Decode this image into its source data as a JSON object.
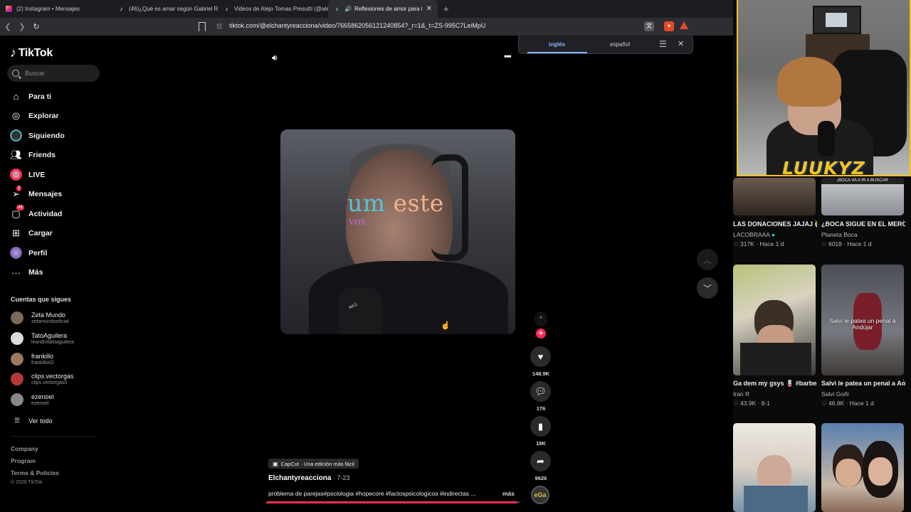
{
  "browser": {
    "tabs": [
      {
        "label": "(2) Instagram • Mensajes",
        "icon": "instagram-icon"
      },
      {
        "label": "(46)¿Qué es amar según Gabriel Rolón",
        "icon": "tiktok-icon"
      },
      {
        "label": "Videos de Alejo Tomas Presutti (@alejo",
        "icon": "tiktok-icon"
      },
      {
        "label": "Reflexiones de amor para tu pareja",
        "icon": "tiktok-icon",
        "active": true
      }
    ],
    "new_tab": "+",
    "url": "tiktok.com/@elchantyreacciona/video/7665862056121240854?_r=1&_t=ZS-995C7LeiMpU"
  },
  "translate_popup": {
    "lang_from": "inglés",
    "lang_to": "español"
  },
  "sidebar": {
    "logo": "TikTok",
    "search_placeholder": "Buscar",
    "nav": [
      {
        "label": "Para ti",
        "icon": "home-icon"
      },
      {
        "label": "Explorar",
        "icon": "compass-icon"
      },
      {
        "label": "Siguiendo",
        "icon": "following-icon"
      },
      {
        "label": "Friends",
        "icon": "friends-icon"
      },
      {
        "label": "LIVE",
        "icon": "live-icon"
      },
      {
        "label": "Mensajes",
        "icon": "messages-icon",
        "badge": "2"
      },
      {
        "label": "Actividad",
        "icon": "activity-icon",
        "badge": "44"
      },
      {
        "label": "Cargar",
        "icon": "upload-icon"
      },
      {
        "label": "Perfil",
        "icon": "profile-icon"
      },
      {
        "label": "Más",
        "icon": "more-icon"
      }
    ],
    "following_title": "Cuentas que sigues",
    "accounts": [
      {
        "name": "Zeta Mundo",
        "user": "zetamundooficial"
      },
      {
        "name": "TatoAguilera",
        "user": "leandrotatoaguilera"
      },
      {
        "name": "frankillo",
        "user": "frankillo02"
      },
      {
        "name": "clips.vectorgas",
        "user": "clips.vectorgas0"
      },
      {
        "name": "ezenoel",
        "user": "ezenoel"
      }
    ],
    "see_all": "Ver todo",
    "footer": [
      "Company",
      "Program",
      "Terms & Policies"
    ],
    "copyright": "© 2026 TikTok"
  },
  "video": {
    "caption_1a": "um",
    "caption_1b": "este",
    "caption_2": "vos",
    "capcut": "CapCut · Una edición más fácil",
    "author": "Elchantyreacciona",
    "date": " · 7-23",
    "description": "problema de parejas#psciologia #hopecore #factospsicologicos #indirectas ...",
    "more": "más",
    "progress": 0.99
  },
  "actions": {
    "likes": "148.9K",
    "comments": "176",
    "saves": "18K",
    "shares": "9626",
    "music_label": "eGa"
  },
  "webcam": {
    "logo": "LUUKYZ"
  },
  "recommendations": [
    {
      "title": "LAS DONACIONES JAJAJ 😭 #lacobra...",
      "author": "LACOBRAAA",
      "verified": true,
      "stats": "♡ 317K · Hace 1 d",
      "overlay": ""
    },
    {
      "title": "¿BOCA SIGUE EN EL MERCADO DE PASES...",
      "author": "Planeta Boca",
      "verified": false,
      "stats": "♡ 6018 · Hace 1 d",
      "overlay": "¡BOCA VA A IR A BUSCAR"
    },
    {
      "title": "Ga dem my gsys 🪫 #barberiaencasa...",
      "author": "Iran R",
      "verified": false,
      "stats": "♡ 43.9K · 8-1",
      "overlay": ""
    },
    {
      "title": "Salvi le patea un penal a Andújar, ex arquero...",
      "author": "Salvi Goñi",
      "verified": false,
      "stats": "♡ 46.9K · Hace 1 d",
      "overlay": "Salvi le patea un penal a Andújar"
    },
    {
      "title": "",
      "author": "",
      "verified": false,
      "stats": "",
      "overlay": ""
    },
    {
      "title": "",
      "author": "",
      "verified": false,
      "stats": "",
      "overlay": ""
    }
  ],
  "colors": {
    "accent": "#fe2c55",
    "translate_blue": "#8ab4f8",
    "streamer_yellow": "#f5c518"
  }
}
